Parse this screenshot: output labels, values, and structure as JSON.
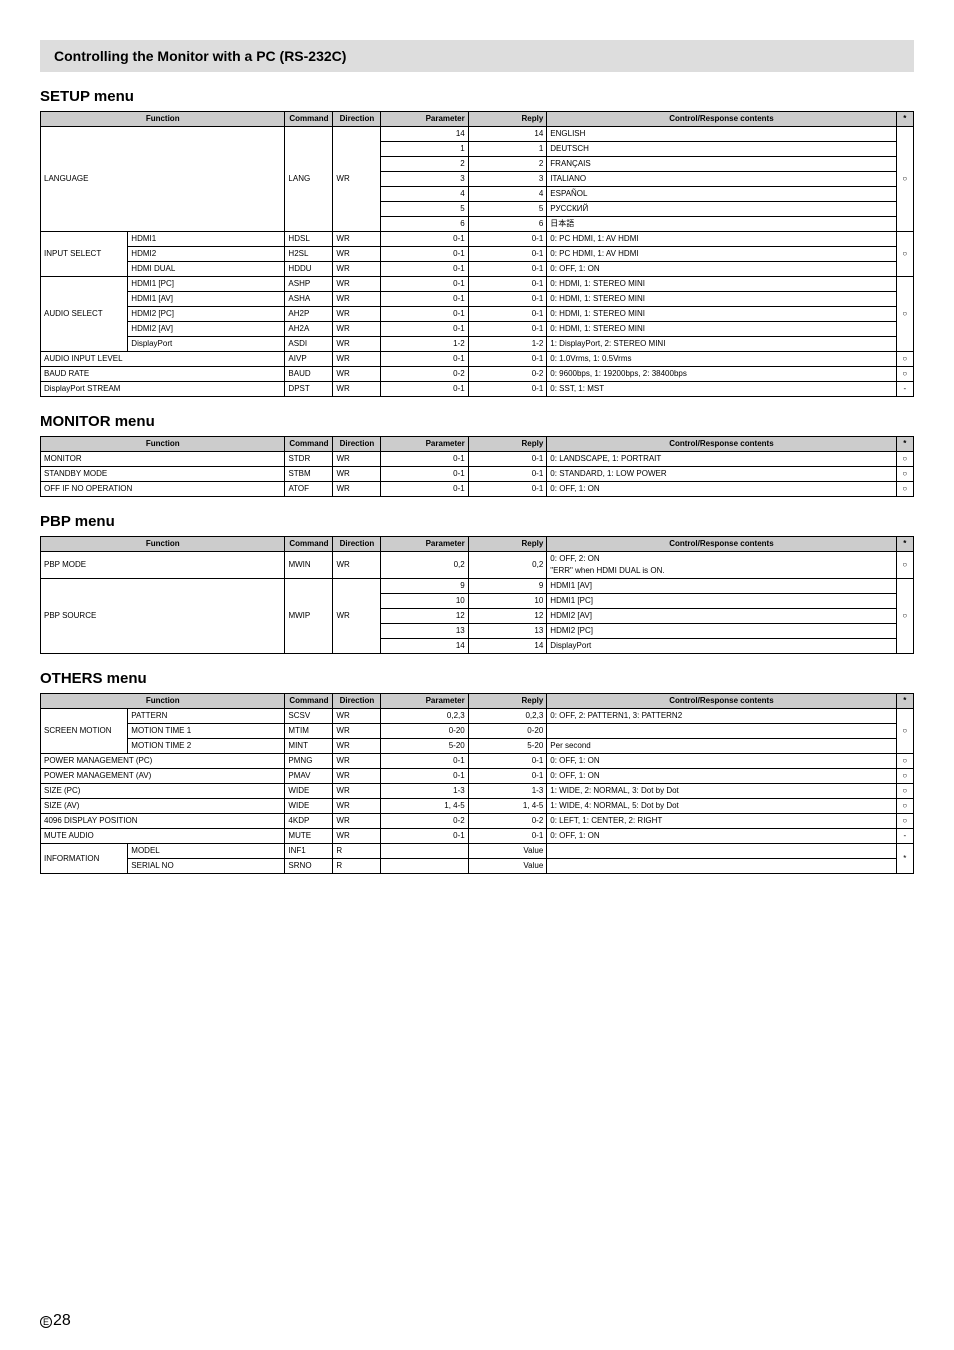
{
  "page": {
    "sectionHeader": "Controlling the Monitor with a PC (RS-232C)",
    "pageNumber": "28",
    "pageMark": "E"
  },
  "headers": {
    "function": "Function",
    "command": "Command",
    "direction": "Direction",
    "parameter": "Parameter",
    "reply": "Reply",
    "content": "Control/Response contents",
    "star": "*"
  },
  "setup": {
    "title": "SETUP menu",
    "lang": {
      "func": "LANGUAGE",
      "cmd": "LANG",
      "dir": "WR",
      "rows": [
        {
          "param": "14",
          "reply": "14",
          "content": "ENGLISH"
        },
        {
          "param": "1",
          "reply": "1",
          "content": "DEUTSCH"
        },
        {
          "param": "2",
          "reply": "2",
          "content": "FRANÇAIS"
        },
        {
          "param": "3",
          "reply": "3",
          "content": "ITALIANO"
        },
        {
          "param": "4",
          "reply": "4",
          "content": "ESPAÑOL"
        },
        {
          "param": "5",
          "reply": "5",
          "content": "РУССКИЙ"
        },
        {
          "param": "6",
          "reply": "6",
          "content": "日本語"
        }
      ],
      "star": "○"
    },
    "inputSelect": {
      "func": "INPUT SELECT",
      "rows": [
        {
          "sub": "HDMI1",
          "cmd": "HDSL",
          "dir": "WR",
          "param": "0-1",
          "reply": "0-1",
          "content": "0: PC HDMI, 1: AV HDMI"
        },
        {
          "sub": "HDMI2",
          "cmd": "H2SL",
          "dir": "WR",
          "param": "0-1",
          "reply": "0-1",
          "content": "0: PC HDMI, 1: AV HDMI"
        },
        {
          "sub": "HDMI DUAL",
          "cmd": "HDDU",
          "dir": "WR",
          "param": "0-1",
          "reply": "0-1",
          "content": "0: OFF, 1: ON"
        }
      ],
      "star": "○"
    },
    "audioSelect": {
      "func": "AUDIO SELECT",
      "rows": [
        {
          "sub": "HDMI1 [PC]",
          "cmd": "ASHP",
          "dir": "WR",
          "param": "0-1",
          "reply": "0-1",
          "content": "0: HDMI, 1: STEREO MINI"
        },
        {
          "sub": "HDMI1 [AV]",
          "cmd": "ASHA",
          "dir": "WR",
          "param": "0-1",
          "reply": "0-1",
          "content": "0: HDMI, 1: STEREO MINI"
        },
        {
          "sub": "HDMI2 [PC]",
          "cmd": "AH2P",
          "dir": "WR",
          "param": "0-1",
          "reply": "0-1",
          "content": "0: HDMI, 1: STEREO MINI"
        },
        {
          "sub": "HDMI2 [AV]",
          "cmd": "AH2A",
          "dir": "WR",
          "param": "0-1",
          "reply": "0-1",
          "content": "0: HDMI, 1: STEREO MINI"
        },
        {
          "sub": "DisplayPort",
          "cmd": "ASDI",
          "dir": "WR",
          "param": "1-2",
          "reply": "1-2",
          "content": "1: DisplayPort, 2: STEREO MINI"
        }
      ],
      "star": "○"
    },
    "audioInput": {
      "func": "AUDIO INPUT LEVEL",
      "cmd": "AIVP",
      "dir": "WR",
      "param": "0-1",
      "reply": "0-1",
      "content": "0: 1.0Vrms, 1: 0.5Vrms",
      "star": "○"
    },
    "baudRate": {
      "func": "BAUD RATE",
      "cmd": "BAUD",
      "dir": "WR",
      "param": "0-2",
      "reply": "0-2",
      "content": "0: 9600bps, 1: 19200bps, 2: 38400bps",
      "star": "○"
    },
    "dpStream": {
      "func": "DisplayPort STREAM",
      "cmd": "DPST",
      "dir": "WR",
      "param": "0-1",
      "reply": "0-1",
      "content": "0: SST, 1: MST",
      "star": "-"
    }
  },
  "monitor": {
    "title": "MONITOR menu",
    "rows": [
      {
        "func": "MONITOR",
        "cmd": "STDR",
        "dir": "WR",
        "param": "0-1",
        "reply": "0-1",
        "content": "0: LANDSCAPE, 1: PORTRAIT",
        "star": "○"
      },
      {
        "func": "STANDBY MODE",
        "cmd": "STBM",
        "dir": "WR",
        "param": "0-1",
        "reply": "0-1",
        "content": "0: STANDARD, 1: LOW POWER",
        "star": "○"
      },
      {
        "func": "OFF IF NO OPERATION",
        "cmd": "ATOF",
        "dir": "WR",
        "param": "0-1",
        "reply": "0-1",
        "content": "0: OFF, 1: ON",
        "star": "○"
      }
    ]
  },
  "pbp": {
    "title": "PBP menu",
    "mode": {
      "func": "PBP MODE",
      "cmd": "MWIN",
      "dir": "WR",
      "param": "0,2",
      "reply": "0,2",
      "content": "0: OFF, 2: ON\n\"ERR\" when HDMI DUAL is ON.",
      "star": "○"
    },
    "source": {
      "func": "PBP SOURCE",
      "cmd": "MWIP",
      "dir": "WR",
      "rows": [
        {
          "param": "9",
          "reply": "9",
          "content": "HDMI1 [AV]"
        },
        {
          "param": "10",
          "reply": "10",
          "content": "HDMI1 [PC]"
        },
        {
          "param": "12",
          "reply": "12",
          "content": "HDMI2 [AV]"
        },
        {
          "param": "13",
          "reply": "13",
          "content": "HDMI2 [PC]"
        },
        {
          "param": "14",
          "reply": "14",
          "content": "DisplayPort"
        }
      ],
      "star": "○"
    }
  },
  "others": {
    "title": "OTHERS menu",
    "screen": {
      "func": "SCREEN MOTION",
      "rows": [
        {
          "sub": "PATTERN",
          "cmd": "SCSV",
          "dir": "WR",
          "param": "0,2,3",
          "reply": "0,2,3",
          "content": "0: OFF, 2: PATTERN1, 3: PATTERN2"
        },
        {
          "sub": "MOTION TIME 1",
          "cmd": "MTIM",
          "dir": "WR",
          "param": "0-20",
          "reply": "0-20",
          "content": ""
        },
        {
          "sub": "MOTION TIME 2",
          "cmd": "MINT",
          "dir": "WR",
          "param": "5-20",
          "reply": "5-20",
          "content": "Per second"
        }
      ],
      "star": "○"
    },
    "pmPC": {
      "func": "POWER MANAGEMENT (PC)",
      "cmd": "PMNG",
      "dir": "WR",
      "param": "0-1",
      "reply": "0-1",
      "content": "0: OFF, 1: ON",
      "star": "○"
    },
    "pmAV": {
      "func": "POWER MANAGEMENT (AV)",
      "cmd": "PMAV",
      "dir": "WR",
      "param": "0-1",
      "reply": "0-1",
      "content": "0: OFF, 1: ON",
      "star": "○"
    },
    "sizePC": {
      "func": "SIZE (PC)",
      "cmd": "WIDE",
      "dir": "WR",
      "param": "1-3",
      "reply": "1-3",
      "content": "1: WIDE, 2: NORMAL, 3: Dot by Dot",
      "star": "○"
    },
    "sizeAV": {
      "func": "SIZE (AV)",
      "cmd": "WIDE",
      "dir": "WR",
      "param": "1, 4-5",
      "reply": "1, 4-5",
      "content": "1: WIDE, 4: NORMAL, 5: Dot by Dot",
      "star": "○"
    },
    "dispPos": {
      "func": "4096 DISPLAY POSITION",
      "cmd": "4KDP",
      "dir": "WR",
      "param": "0-2",
      "reply": "0-2",
      "content": "0: LEFT, 1: CENTER, 2: RIGHT",
      "star": "○"
    },
    "mute": {
      "func": "MUTE AUDIO",
      "cmd": "MUTE",
      "dir": "WR",
      "param": "0-1",
      "reply": "0-1",
      "content": "0: OFF, 1: ON",
      "star": "-"
    },
    "info": {
      "func": "INFORMATION",
      "rows": [
        {
          "sub": "MODEL",
          "cmd": "INF1",
          "dir": "R",
          "param": "",
          "reply": "Value",
          "content": ""
        },
        {
          "sub": "SERIAL NO",
          "cmd": "SRNO",
          "dir": "R",
          "param": "",
          "reply": "Value",
          "content": ""
        }
      ],
      "star": "*"
    }
  }
}
